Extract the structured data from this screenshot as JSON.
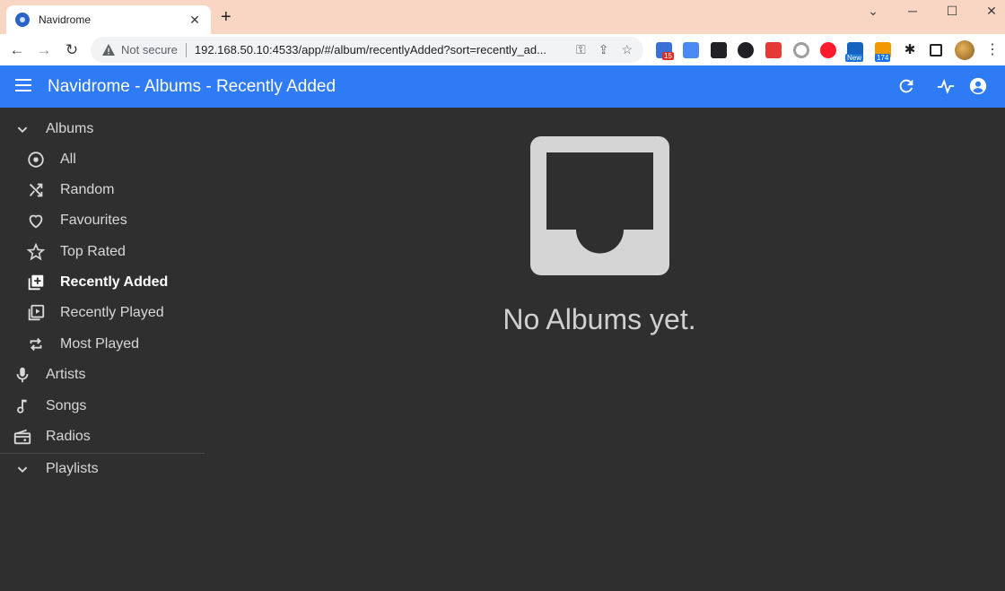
{
  "browser": {
    "tab_title": "Navidrome",
    "tab_close": "✕",
    "new_tab": "+",
    "security_label": "Not secure",
    "url": "192.168.50.10:4533/app/#/album/recentlyAdded?sort=recently_ad...",
    "ext_badges": [
      "15",
      "New",
      "174"
    ]
  },
  "appbar": {
    "title": "Navidrome - Albums - Recently Added"
  },
  "sidebar": {
    "albums_section": "Albums",
    "items": [
      {
        "label": "All",
        "icon": "album-disc-icon"
      },
      {
        "label": "Random",
        "icon": "shuffle-icon"
      },
      {
        "label": "Favourites",
        "icon": "heart-icon"
      },
      {
        "label": "Top Rated",
        "icon": "star-icon"
      },
      {
        "label": "Recently Added",
        "icon": "library-add-icon",
        "active": true
      },
      {
        "label": "Recently Played",
        "icon": "library-play-icon"
      },
      {
        "label": "Most Played",
        "icon": "repeat-icon"
      }
    ],
    "artists": "Artists",
    "songs": "Songs",
    "radios": "Radios",
    "playlists": "Playlists"
  },
  "main": {
    "empty_message": "No Albums yet."
  },
  "colors": {
    "appbar": "#2f7bf5",
    "background": "#2f2f2f",
    "tabstrip": "#f9d6c3"
  }
}
